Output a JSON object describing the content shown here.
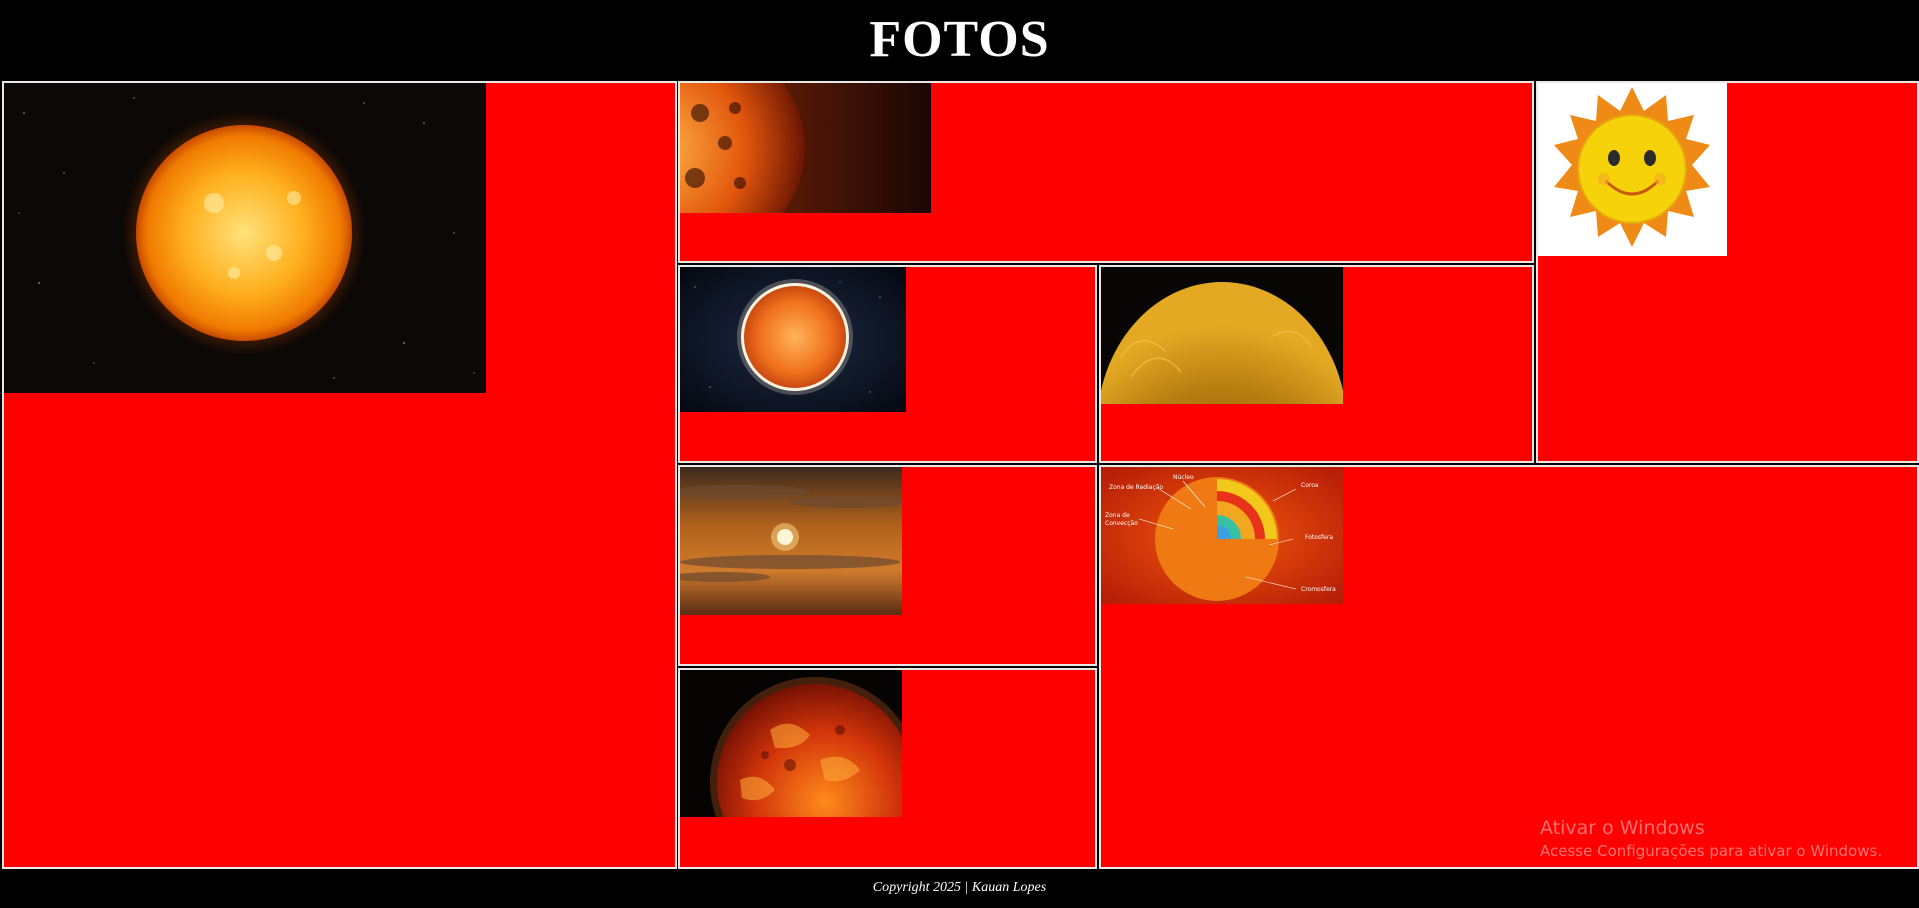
{
  "page": {
    "title": "FOTOS"
  },
  "gallery": {
    "photos": [
      {
        "name": "sun-in-starfield-photo"
      },
      {
        "name": "sun-surface-closeup-photo"
      },
      {
        "name": "cartoon-smiling-sun-image"
      },
      {
        "name": "sun-in-space-photo"
      },
      {
        "name": "golden-sun-corona-photo"
      },
      {
        "name": "sunset-sky-photo"
      },
      {
        "name": "sun-structure-diagram-image",
        "labels": [
          "Núcleo",
          "Zona de Radiação",
          "Zona de",
          "Convecção",
          "Coroa",
          "Fotosfera",
          "Cromosfera"
        ]
      },
      {
        "name": "molten-sun-surface-photo"
      }
    ]
  },
  "footer": {
    "copyright": "Copyright 2025 | Kauan Lopes"
  },
  "watermark": {
    "title": "Ativar o Windows",
    "subtitle": "Acesse Configurações para ativar o Windows."
  },
  "colors": {
    "background": "#000000",
    "cell": "#ff0000",
    "border": "#e8e8e8",
    "text": "#ffffff"
  }
}
